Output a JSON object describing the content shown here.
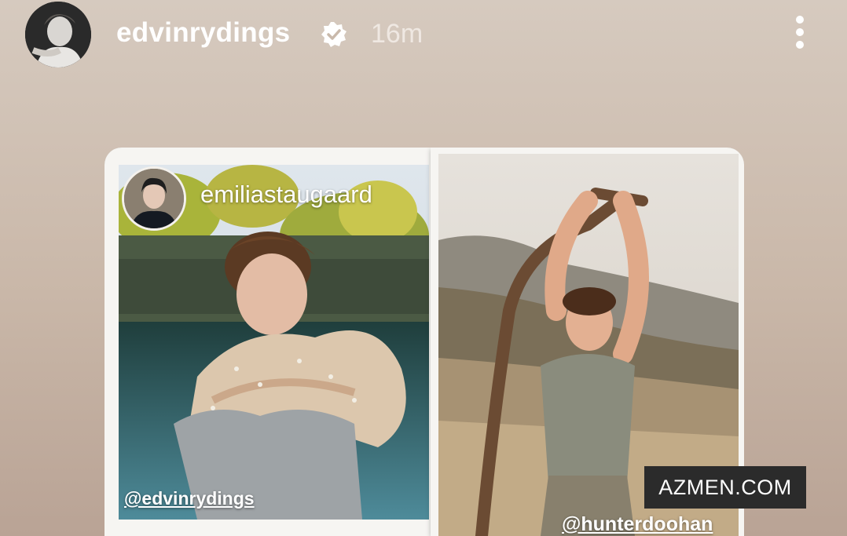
{
  "header": {
    "username": "edvinrydings",
    "verified_icon": "verified-badge-icon",
    "time_ago": "16m",
    "more_icon": "more-vertical-icon"
  },
  "story": {
    "mention": {
      "username": "emiliastaugaard"
    },
    "photo_tags": [
      "@edvinrydings",
      "@hunterdoohan"
    ],
    "watermark": "AZMEN.COM"
  },
  "colors": {
    "background_top": "#d6cabf",
    "background_bottom": "#b9a395",
    "text": "#ffffff"
  }
}
